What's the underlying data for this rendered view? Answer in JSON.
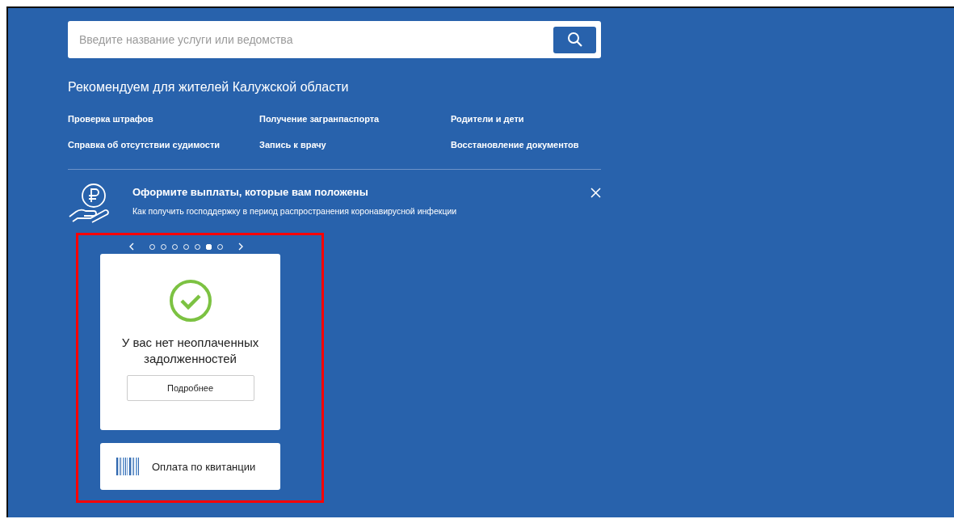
{
  "search": {
    "placeholder": "Введите название услуги или ведомства"
  },
  "recommend": {
    "title": "Рекомендуем для жителей Калужской области",
    "links": [
      "Проверка штрафов",
      "Получение загранпаспорта",
      "Родители и дети",
      "Справка об отсутствии судимости",
      "Запись к врачу",
      "Восстановление документов"
    ]
  },
  "banner": {
    "title": "Оформите выплаты, которые вам положены",
    "subtitle": "Как получить господдержку в период распространения коронавирусной инфекции"
  },
  "carousel": {
    "dots": [
      {
        "selected": false
      },
      {
        "selected": false
      },
      {
        "selected": false
      },
      {
        "selected": false
      },
      {
        "selected": false
      },
      {
        "selected": true
      },
      {
        "selected": false
      }
    ]
  },
  "status_card": {
    "message": "У вас нет неоплаченных задолженностей",
    "button": "Подробнее"
  },
  "payment_card": {
    "label": "Оплата по квитанции"
  }
}
